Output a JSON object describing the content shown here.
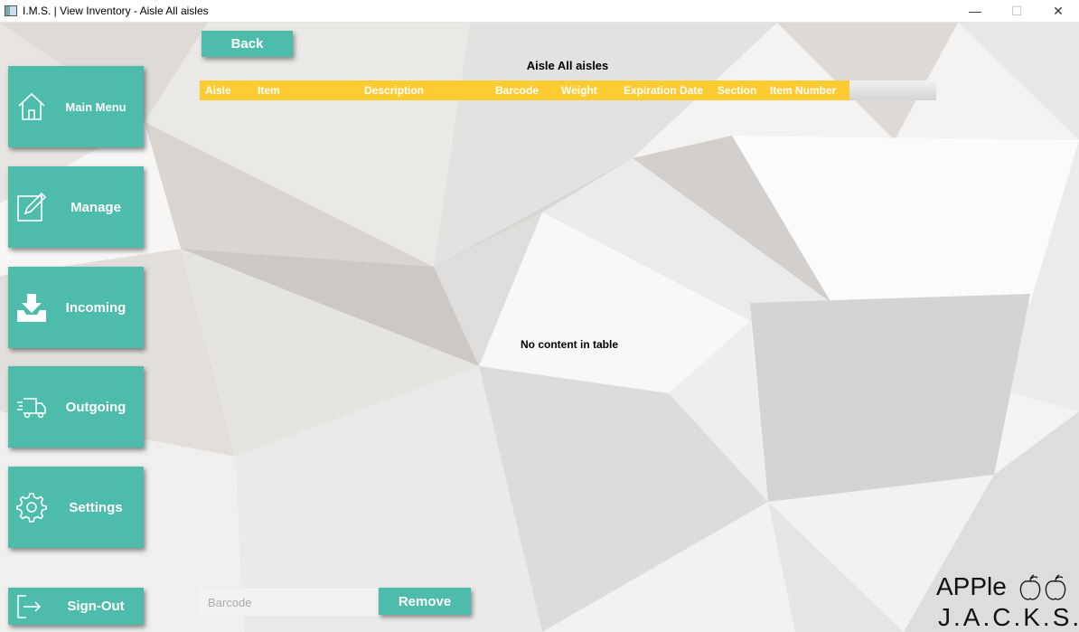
{
  "window": {
    "title": "I.M.S. | View Inventory - Aisle All aisles",
    "minimize": "—",
    "maximize": "☐",
    "close": "✕"
  },
  "sidebar": {
    "items": [
      {
        "label": "Main Menu",
        "icon": "home-icon"
      },
      {
        "label": "Manage",
        "icon": "edit-icon"
      },
      {
        "label": "Incoming",
        "icon": "inbox-download-icon"
      },
      {
        "label": "Outgoing",
        "icon": "truck-icon"
      },
      {
        "label": "Settings",
        "icon": "gear-icon"
      },
      {
        "label": "Sign-Out",
        "icon": "sign-out-icon"
      }
    ]
  },
  "toolbar": {
    "back_label": "Back"
  },
  "table": {
    "title": "Aisle All aisles",
    "columns": [
      "Aisle",
      "Item",
      "Description",
      "Barcode",
      "Weight",
      "Expiration Date",
      "Section",
      "Item Number"
    ],
    "rows": [],
    "empty_message": "No content in table"
  },
  "remove_form": {
    "barcode_placeholder": "Barcode",
    "barcode_value": "",
    "remove_label": "Remove"
  },
  "logo": {
    "line1": "APPle",
    "line2": "J.A.C.K.S."
  },
  "colors": {
    "accent": "#4dbcab",
    "header": "#fdcb32"
  }
}
